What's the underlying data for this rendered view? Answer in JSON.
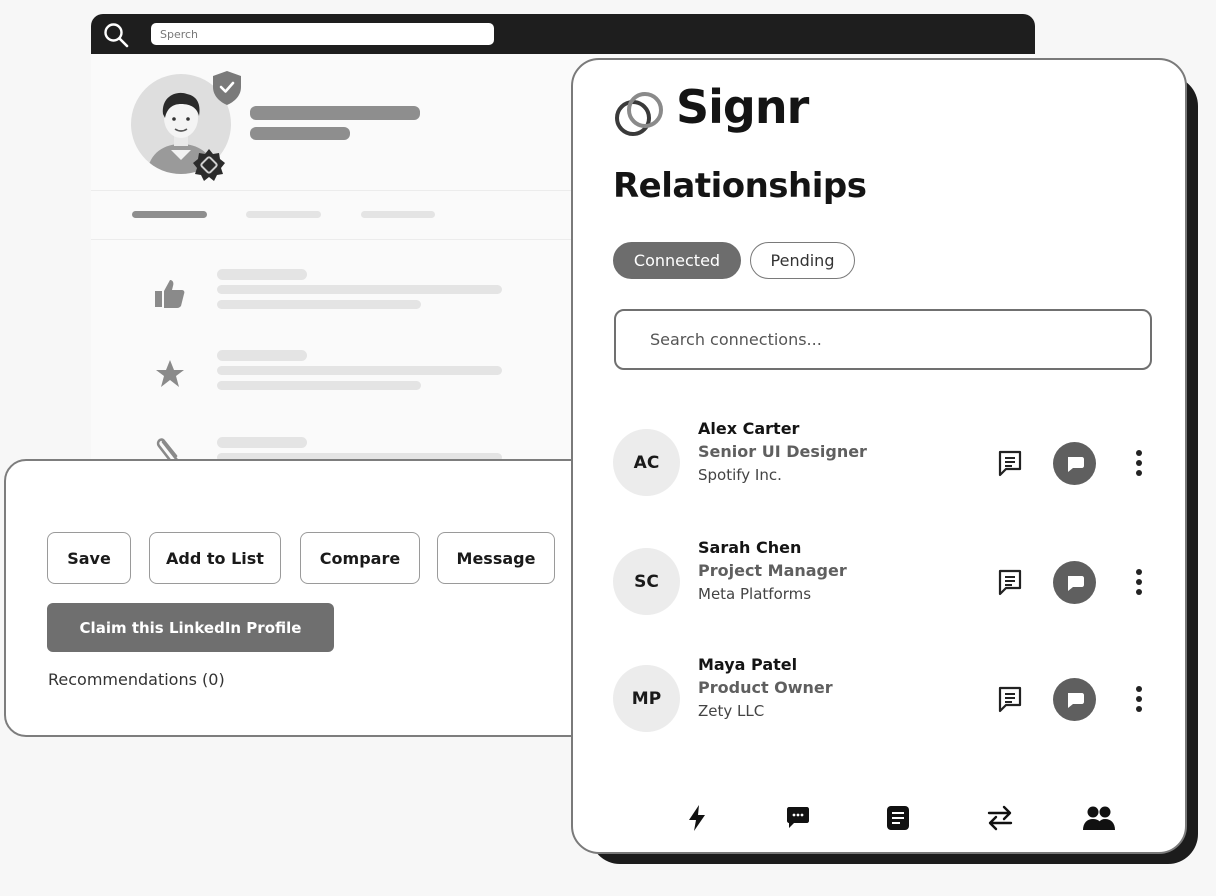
{
  "browser": {
    "search_placeholder": "Sperch",
    "icons": [
      "search-icon",
      "verified-shield-icon",
      "gear-badge-icon",
      "thumbs-up-icon",
      "star-icon",
      "paperclip-icon"
    ]
  },
  "action_card": {
    "buttons": {
      "save": "Save",
      "add_to_list": "Add to List",
      "compare": "Compare",
      "message": "Message"
    },
    "claim": "Claim this LinkedIn Profile",
    "recommendations": "Recommendations (0)"
  },
  "signr": {
    "brand": "Signr",
    "title": "Relationships",
    "tabs": {
      "connected": "Connected",
      "pending": "Pending"
    },
    "active_tab": "Connected",
    "search_placeholder": "Search connections...",
    "contacts": [
      {
        "initials": "AC",
        "name": "Alex Carter",
        "role": "Senior UI Designer",
        "company": "Spotify Inc."
      },
      {
        "initials": "SC",
        "name": "Sarah Chen",
        "role": "Project Manager",
        "company": "Meta Platforms"
      },
      {
        "initials": "MP",
        "name": "Maya Patel",
        "role": "Product Owner",
        "company": "Zety LLC"
      }
    ],
    "bottom_nav": [
      "bolt-icon",
      "chat-icon",
      "document-icon",
      "swap-icon",
      "people-icon"
    ]
  },
  "colors": {
    "dark": "#1e1e1e",
    "accent_gray": "#6d6d6d",
    "light_bg": "#f7f7f7"
  }
}
